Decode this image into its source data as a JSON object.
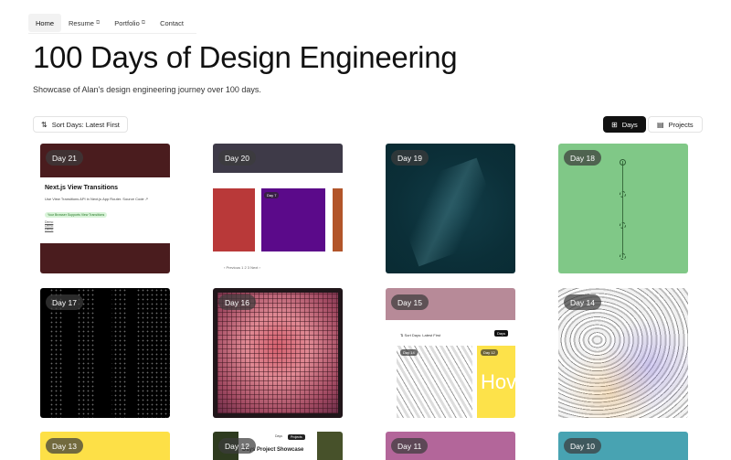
{
  "nav": {
    "items": [
      {
        "label": "Home",
        "active": true,
        "external": false
      },
      {
        "label": "Resume",
        "active": false,
        "external": true
      },
      {
        "label": "Portfolio",
        "active": false,
        "external": true
      },
      {
        "label": "Contact",
        "active": false,
        "external": false
      }
    ]
  },
  "header": {
    "title": "100 Days of Design Engineering",
    "subtitle": "Showcase of Alan's design engineering journey over 100 days."
  },
  "controls": {
    "sort_label": "Sort Days: Latest First",
    "days_label": "Days",
    "projects_label": "Projects",
    "active_view": "Days"
  },
  "cards": [
    {
      "label": "Day 21"
    },
    {
      "label": "Day 20"
    },
    {
      "label": "Day 19"
    },
    {
      "label": "Day 18"
    },
    {
      "label": "Day 17"
    },
    {
      "label": "Day 16"
    },
    {
      "label": "Day 15"
    },
    {
      "label": "Day 14"
    },
    {
      "label": "Day 13"
    },
    {
      "label": "Day 12"
    },
    {
      "label": "Day 11"
    },
    {
      "label": "Day 10"
    }
  ],
  "previews": {
    "day21": {
      "heading": "Next.js View Transitions",
      "line": "Use View Transitions API in Next.js App Router. Source Code ↗",
      "pill": "Your Browser Supports View Transitions",
      "links": [
        "Demo",
        "Demo",
        "Demo"
      ]
    },
    "day20": {
      "tile": "Day 7",
      "pager": "‹ Previous   1   2   3   Next ›"
    },
    "day15": {
      "sort": "⇅ Sort Days: Latest First",
      "days": "Days",
      "a": "Day 14",
      "b": "Day 12",
      "hover": "Hov"
    },
    "day12": {
      "title": "Days Project Showcase",
      "days": "Days",
      "projects": "Projects"
    }
  },
  "colors": {
    "primary": "#111111",
    "day21": "#4a1c1e",
    "day20": "#3e3a48",
    "day19": "#0b2f38",
    "day18": "#80c887",
    "day17": "#000000",
    "day16": "#d4606e",
    "day15": "#b78a98",
    "day14": "#eeeeee",
    "day13": "#fde047",
    "day12": "#2e3b1f",
    "day11": "#b3669a",
    "day10": "#48a3b2"
  },
  "icons": {
    "sort": "sort-arrows-icon",
    "days": "grid-icon",
    "projects": "projects-icon",
    "external": "external-link-icon"
  }
}
